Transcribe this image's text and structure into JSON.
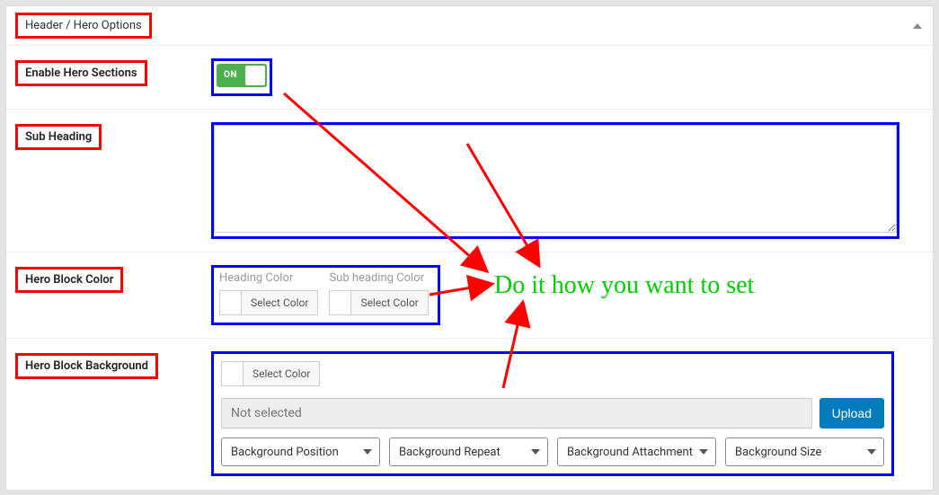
{
  "panel": {
    "title": "Header / Hero Options"
  },
  "rows": {
    "enable": {
      "label": "Enable Hero Sections",
      "toggle_state": "ON"
    },
    "sub_heading": {
      "label": "Sub Heading",
      "value": ""
    },
    "block_color": {
      "label": "Hero Block Color",
      "heading_label": "Heading Color",
      "subheading_label": "Sub heading Color",
      "select_text": "Select Color"
    },
    "block_bg": {
      "label": "Hero Block Background",
      "select_text": "Select Color",
      "not_selected_text": "Not selected",
      "upload_label": "Upload",
      "selects": [
        "Background Position",
        "Background Repeat",
        "Background Attachment",
        "Background Size"
      ]
    }
  },
  "annotation": {
    "text": "Do it how you want to set"
  }
}
